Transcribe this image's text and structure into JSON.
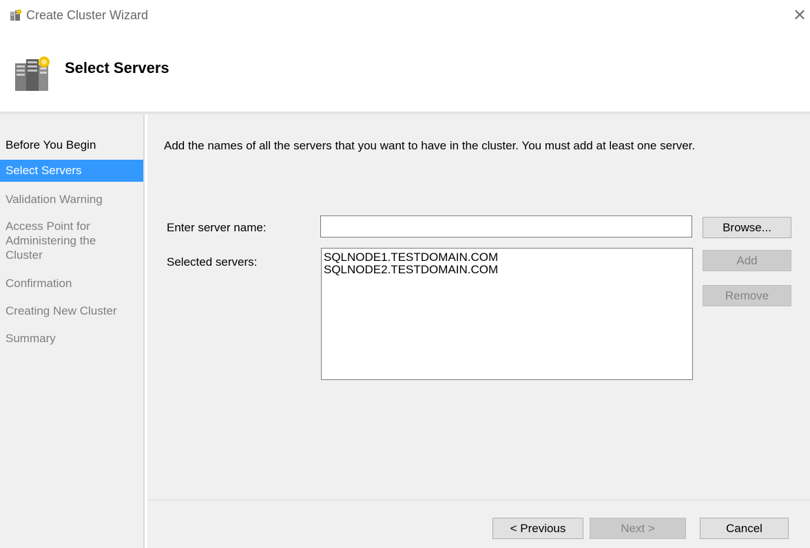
{
  "window": {
    "title": "Create Cluster Wizard",
    "close_symbol": "✕",
    "app_icon": "cluster-wizard-icon"
  },
  "header": {
    "title": "Select Servers",
    "icon": "servers-icon"
  },
  "sidebar": {
    "items": [
      {
        "label": "Before You Begin",
        "state": "done"
      },
      {
        "label": "Select Servers",
        "state": "active"
      },
      {
        "label": "Validation Warning",
        "state": "pending"
      },
      {
        "label": "Access Point for Administering the Cluster",
        "line1": "Access Point for",
        "line2": "Administering the",
        "line3": "Cluster",
        "state": "pending"
      },
      {
        "label": "Confirmation",
        "state": "pending"
      },
      {
        "label": "Creating New Cluster",
        "state": "pending"
      },
      {
        "label": "Summary",
        "state": "pending"
      }
    ]
  },
  "main": {
    "intro": "Add the names of all the servers that you want to have in the cluster. You must add at least one server.",
    "server_name_label": "Enter server name:",
    "server_name_value": "",
    "selected_label": "Selected servers:",
    "selected_servers": [
      "SQLNODE1.TESTDOMAIN.COM",
      "SQLNODE2.TESTDOMAIN.COM"
    ],
    "browse_label": "Browse...",
    "add_label": "Add",
    "remove_label": "Remove"
  },
  "footer": {
    "previous_label": "< Previous",
    "next_label": "Next >",
    "cancel_label": "Cancel"
  },
  "colors": {
    "selection": "#3399ff",
    "panel": "#f0f0f0",
    "disabled_text": "#838383"
  }
}
